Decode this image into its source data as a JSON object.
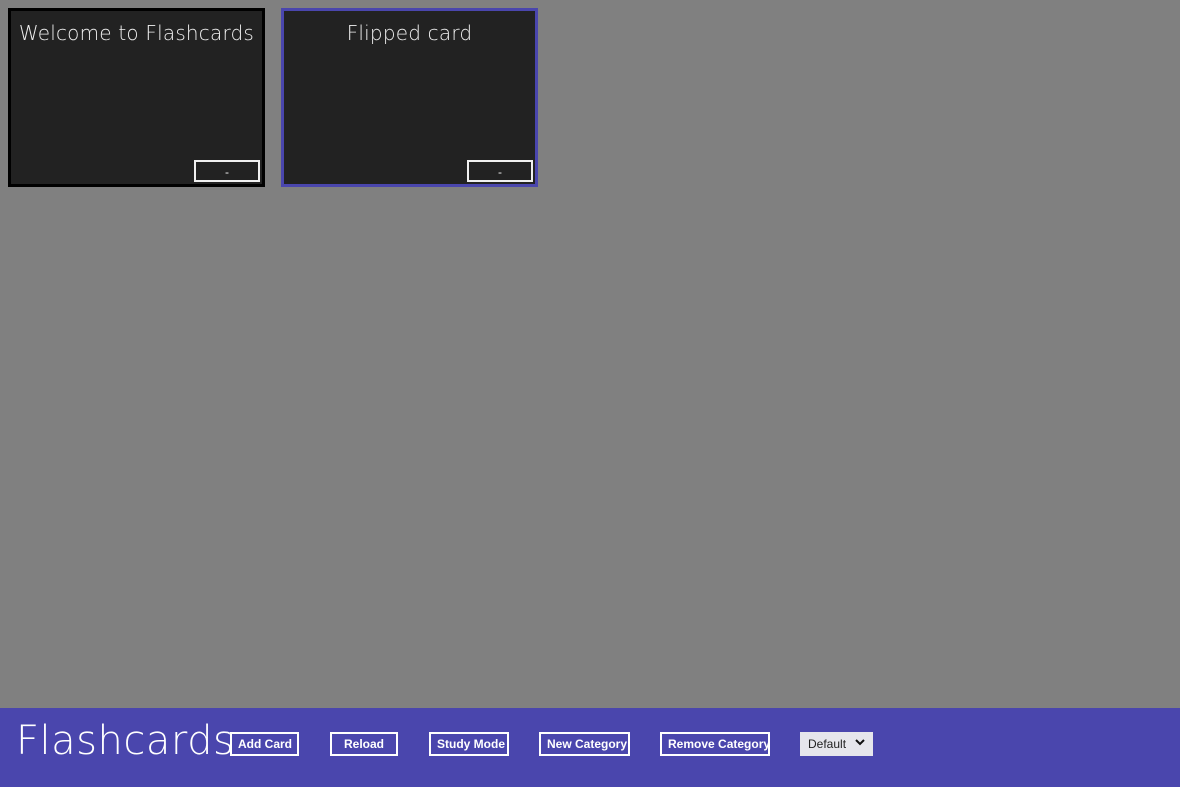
{
  "colors": {
    "board_background": "#808080",
    "card_background": "#222222",
    "card_border": "#000000",
    "flipped_card_border": "#4a46ad",
    "appbar_background": "#4a46ad"
  },
  "cards": [
    {
      "title": "Welcome to Flashcards",
      "button_label": "-",
      "state": "normal"
    },
    {
      "title": "Flipped card",
      "button_label": "-",
      "state": "flipped"
    }
  ],
  "appbar": {
    "title": "Flashcards",
    "buttons": {
      "add_card": "Add Card",
      "reload": "Reload",
      "study_mode": "Study Mode",
      "new_category": "New Category",
      "remove_category": "Remove Category"
    },
    "category_select": {
      "selected": "Default",
      "icon": "chevron-down-icon"
    }
  }
}
